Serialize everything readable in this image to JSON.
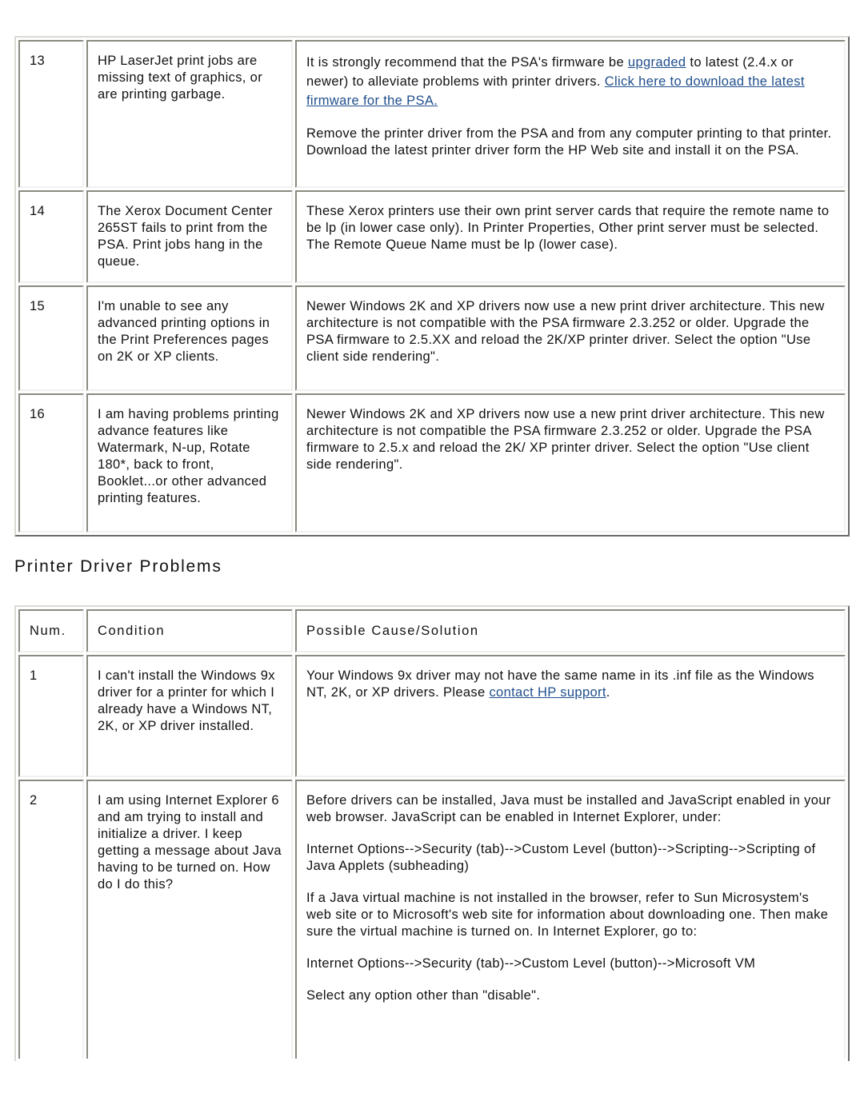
{
  "table1": {
    "rows": [
      {
        "num": "13",
        "condition": "HP LaserJet print jobs are missing text of graphics, or are printing garbage.",
        "solution": {
          "p1_pre": "It is strongly recommend that the PSA's firmware be ",
          "p1_link1": "upgraded",
          "p1_mid": " to latest (2.4.x or newer) to alleviate problems with printer drivers. ",
          "p1_link2": "Click here to download the latest firmware for the PSA.",
          "p2": "Remove the printer driver from the PSA and from any computer printing to that printer. Download the latest printer driver form the HP Web site and install it on the PSA."
        }
      },
      {
        "num": "14",
        "condition": "The Xerox Document Center 265ST fails to print from the PSA. Print jobs hang in the queue.",
        "solution": "These Xerox printers use their own print server cards that require the remote name to be lp (in lower case only). In Printer Properties, Other print server must be selected. The Remote Queue Name must be lp (lower case)."
      },
      {
        "num": "15",
        "condition": "I'm unable to see any advanced printing options in the Print Preferences pages on 2K or XP clients.",
        "solution": "Newer Windows 2K and XP drivers now use a new print driver architecture. This new architecture is not compatible with the PSA firmware 2.3.252 or older. Upgrade the PSA firmware to 2.5.XX and reload the 2K/XP printer driver. Select the option \"Use client side rendering\"."
      },
      {
        "num": "16",
        "condition": "I am having problems printing advance features like Watermark, N-up, Rotate 180*, back to front, Booklet...or other advanced printing features.",
        "solution": "Newer Windows 2K and XP drivers now use a new print driver architecture. This new architecture is not compatible the PSA firmware 2.3.252 or older. Upgrade the PSA firmware to 2.5.x and reload the 2K/ XP printer driver. Select the option \"Use client side rendering\"."
      }
    ]
  },
  "section": {
    "title": "Printer Driver Problems"
  },
  "table2": {
    "headers": {
      "num": "Num.",
      "condition": "Condition",
      "solution": "Possible Cause/Solution"
    },
    "rows": [
      {
        "num": "1",
        "condition": "I can't install the Windows 9x driver for a printer for which I already have a Windows NT, 2K, or XP driver installed.",
        "solution": {
          "pre": "Your Windows 9x driver may not have the same name in its .inf file as the Windows NT, 2K, or XP drivers. Please ",
          "link": "contact HP support",
          "post": "."
        }
      },
      {
        "num": "2",
        "condition": "I am using Internet Explorer 6 and am trying to install and initialize a driver. I keep getting a message about Java having to be turned on. How do I do this?",
        "solution": {
          "p1": "Before drivers can be installed, Java must be installed and JavaScript enabled in your web browser. JavaScript can be enabled in Internet Explorer, under:",
          "p2": "Internet Options-->Security (tab)-->Custom Level (button)-->Scripting-->Scripting of Java Applets (subheading)",
          "p3": "If a Java virtual machine is not installed in the browser, refer to Sun Microsystem's web site or to Microsoft's web site for information about downloading one. Then make sure the virtual machine is turned on. In Internet Explorer, go to:",
          "p4": "Internet Options-->Security (tab)-->Custom Level (button)-->Microsoft VM",
          "p5": "Select any option other than \"disable\"."
        }
      }
    ]
  },
  "colors": {
    "link": "#1f4e8c",
    "text": "#111111",
    "border_dark": "#6a6a6a",
    "border_light": "#d9d9d4"
  }
}
